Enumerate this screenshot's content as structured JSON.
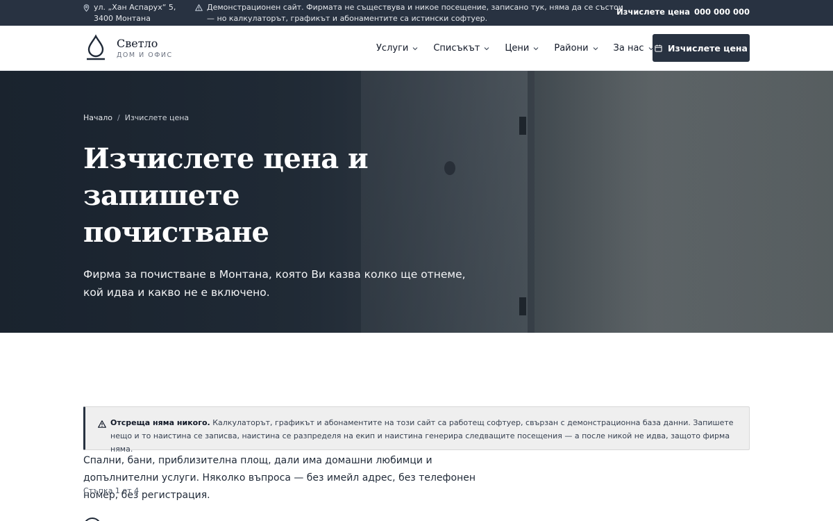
{
  "topbar": {
    "address": "ул. „Хан Аспарух“ 5, 3400 Монтана",
    "notice": "Демонстрационен сайт. Фирмата не съществува и никое посещение, записано тук, няма да се състои — но калкулаторът, графикът и абонаментите са истински софтуер.",
    "cta_label": "Изчислете цена",
    "phone": "000 000 000"
  },
  "header": {
    "brand_name": "Светло",
    "brand_tagline": "ДОМ И ОФИС",
    "nav": [
      {
        "label": "Услуги"
      },
      {
        "label": "Списъкът"
      },
      {
        "label": "Цени"
      },
      {
        "label": "Райони"
      },
      {
        "label": "За нас"
      }
    ],
    "cta_label": "Изчислете цена"
  },
  "hero": {
    "breadcrumb": {
      "home": "Начало",
      "current": "Изчислете цена"
    },
    "title": "Изчислете цена и запишете почистване",
    "lead": "Фирма за почистване в Монтана, която Ви казва колко ще отнеме, кой идва и какво не е включено."
  },
  "alert": {
    "strong": "Отсреща няма никого.",
    "text": "Калкулаторът, графикът и абонаментите на този сайт са работещ софтуер, свързан с демонстрационна база данни. Запишете нещо и то наистина се записва, наистина се разпределя на екип и наистина генерира следващите посещения — а после никой не идва, защото фирма няма."
  },
  "intro": "Спални, бани, приблизителна площ, дали има домашни любимци и допълнителни услуги. Няколко въпроса — без имейл адрес, без телефонен номер, без регистрация.",
  "step_label": "Стъпка 1 от 4",
  "colors": {
    "dark": "#283241",
    "white": "#ffffff"
  },
  "icons": {
    "location": "map-pin-icon",
    "warning": "warning-icon",
    "calendar": "calendar-icon",
    "chevron": "chevron-down-icon",
    "logo": "droplet-icon"
  }
}
